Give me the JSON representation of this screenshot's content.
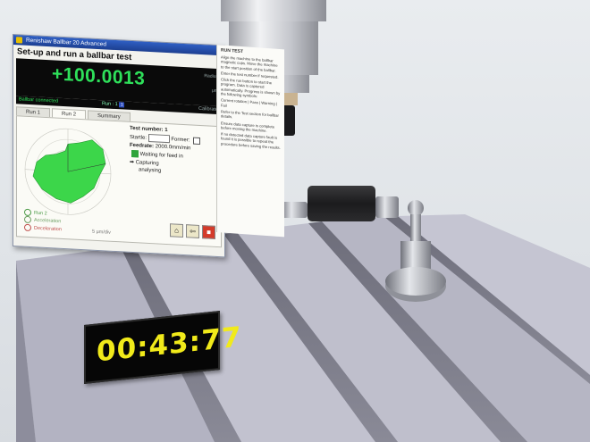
{
  "window": {
    "title": "Renishaw Ballbar 20 Advanced",
    "heading": "Set-up and run a ballbar test",
    "reading": "+100.0013",
    "reading_side_top": "Radius",
    "reading_side_mid": "µm",
    "status_left": "Ballbar connected",
    "run_label": "Run : 1",
    "run_value": "1",
    "status_right": "Calibrate",
    "tabs": [
      "Run 1",
      "Run 2",
      "Summary"
    ],
    "active_tab": 1,
    "test_number_label": "Test number: 1",
    "start_label": "Startle:",
    "former_label": "Former:",
    "feedrate_label": "Feedrate:",
    "feedrate_value": "2000.0mm/min",
    "waiting_label": "Waiting for feed in",
    "capturing_label": "Capturing",
    "analysing_label": "analysing",
    "legend": [
      "Run 2",
      "Acceleration",
      "Deceleration"
    ],
    "scale_note": "5 µm/div"
  },
  "help": {
    "title": "RUN TEST",
    "paragraphs": [
      "Align the machine to the ballbar magnetic cups. Move the machine to the start position of the ballbar.",
      "Enter the test number if requested.",
      "Click the run button to start the program. Data is captured automatically. Progress is shown by the following symbols:",
      "Current rotation  |  Pass  |  Warning  |  Fail",
      "Refer to the Test section for ballbar details.",
      "Ensure data capture is complete before moving the machine.",
      "If no detected data capture fault is found it is possible to repeat the procedure before saving the results."
    ]
  },
  "timer": {
    "value": "00:43:77"
  },
  "colors": {
    "plot_fill": "#3cd64a",
    "display_text": "#2ee05a",
    "timer_text": "#f1ea1a",
    "titlebar": "#2f5fc4",
    "stop_button": "#d43b2a"
  }
}
